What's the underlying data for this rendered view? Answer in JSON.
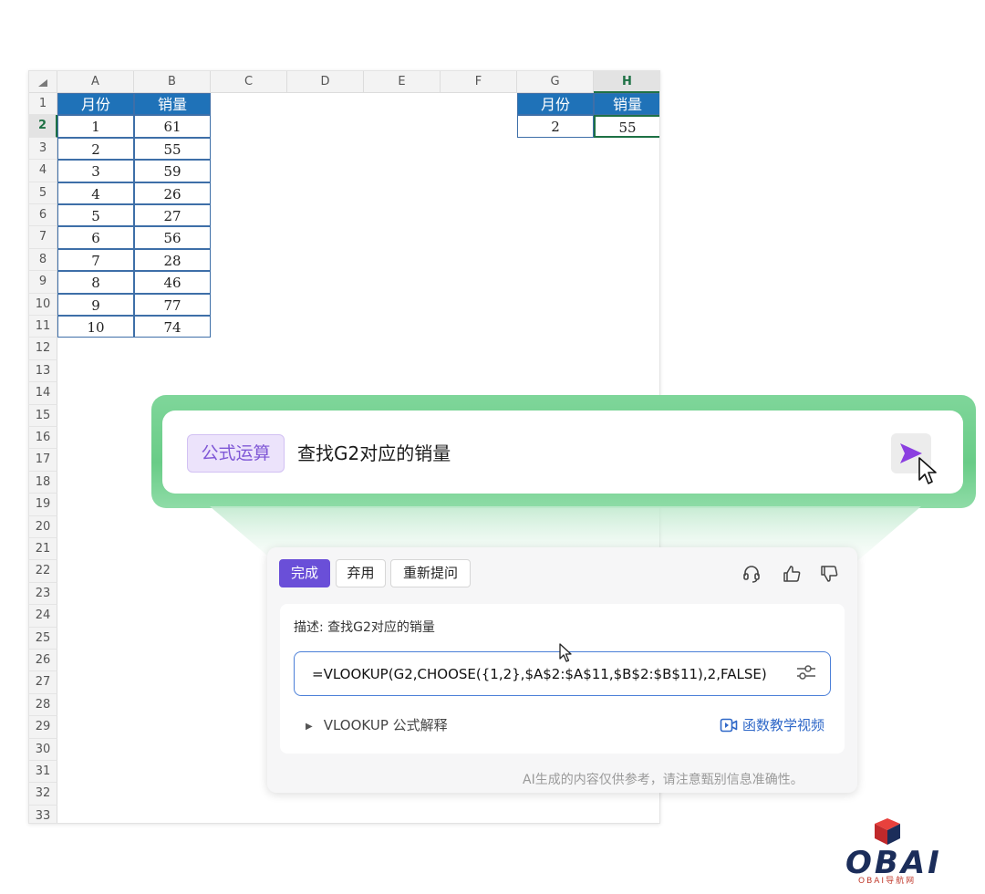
{
  "sheet": {
    "columns": [
      "A",
      "B",
      "C",
      "D",
      "E",
      "F",
      "G",
      "H"
    ],
    "rows": [
      "1",
      "2",
      "3",
      "4",
      "5",
      "6",
      "7",
      "8",
      "9",
      "10",
      "11",
      "12",
      "13",
      "14",
      "15",
      "16",
      "17",
      "18",
      "19",
      "20",
      "21",
      "22",
      "23",
      "24",
      "25",
      "26",
      "27",
      "28",
      "29",
      "30",
      "31",
      "32",
      "33"
    ],
    "selected_column": "H",
    "selected_row": "2",
    "table1": {
      "headers": [
        "月份",
        "销量"
      ],
      "rows": [
        [
          "1",
          "61"
        ],
        [
          "2",
          "55"
        ],
        [
          "3",
          "59"
        ],
        [
          "4",
          "26"
        ],
        [
          "5",
          "27"
        ],
        [
          "6",
          "56"
        ],
        [
          "7",
          "28"
        ],
        [
          "8",
          "46"
        ],
        [
          "9",
          "77"
        ],
        [
          "10",
          "74"
        ]
      ]
    },
    "table2": {
      "headers": [
        "月份",
        "销量"
      ],
      "rows": [
        [
          "2",
          "55"
        ]
      ]
    }
  },
  "prompt": {
    "tag": "公式运算",
    "text": "查找G2对应的销量"
  },
  "result": {
    "buttons": {
      "done": "完成",
      "discard": "弃用",
      "reask": "重新提问"
    },
    "description": "描述: 查找G2对应的销量",
    "formula": "=VLOOKUP(G2,CHOOSE({1,2},$A$2:$A$11,$B$2:$B$11),2,FALSE)",
    "explain_label": "VLOOKUP 公式解释",
    "video_link": "函数教学视频",
    "footnote": "AI生成的内容仅供参考，请注意甄别信息准确性。"
  },
  "colors": {
    "header_fill": "#1f72b8",
    "selection_green": "#1e7145",
    "accent_purple": "#6a4fd8",
    "link_blue": "#2f68c8"
  },
  "logo": {
    "text": "OBAI",
    "subtitle": "OBAI导航网"
  }
}
